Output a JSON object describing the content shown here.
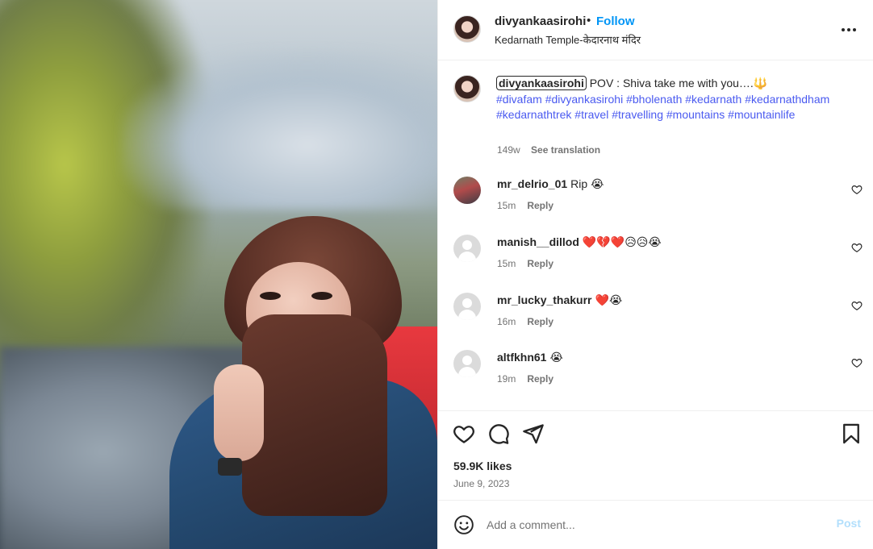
{
  "post": {
    "username": "divyankaasirohi",
    "separator": "•",
    "follow_label": "Follow",
    "location": "Kedarnath Temple-केदारनाथ मंदिर"
  },
  "caption": {
    "username": "divyankaasirohi",
    "text": " POV : Shiva take me with you….🔱",
    "hashtags": "#divafam #divyankasirohi #bholenath #kedarnath #kedarnathdham #kedarnathtrek #travel #travelling #mountains #mountainlife",
    "age": "149w",
    "see_translation": "See translation"
  },
  "comments": [
    {
      "user": "mr_delrio_01",
      "text": "Rip 😭",
      "time": "15m",
      "reply": "Reply"
    },
    {
      "user": "manish__dillod",
      "text": "❤️💔❤️😥😥😭",
      "time": "15m",
      "reply": "Reply"
    },
    {
      "user": "mr_lucky_thakurr",
      "text": "❤️😭",
      "time": "16m",
      "reply": "Reply"
    },
    {
      "user": "altfkhn61",
      "text": "😭",
      "time": "19m",
      "reply": "Reply"
    }
  ],
  "stats": {
    "likes": "59.9K likes",
    "date": "June 9, 2023"
  },
  "comment_box": {
    "placeholder": "Add a comment...",
    "post_label": "Post"
  },
  "icons": {
    "like": "heart-icon",
    "comment": "comment-icon",
    "share": "share-icon",
    "save": "bookmark-icon",
    "more": "more-options-icon",
    "emoji": "emoji-icon"
  },
  "colors": {
    "follow": "#0095f6",
    "hashtag": "#4a5af0",
    "post_disabled": "#b2dffc",
    "muted": "#737373"
  }
}
